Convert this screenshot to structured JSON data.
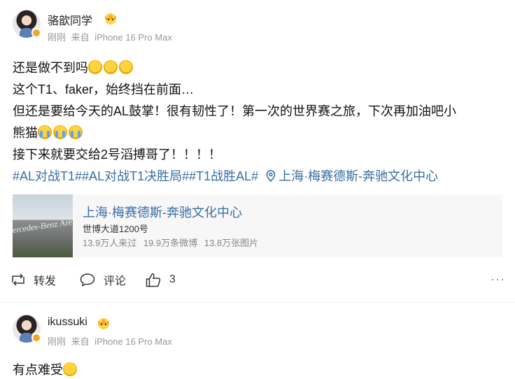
{
  "post1": {
    "author": "骆歆同学",
    "meta_time": "刚刚",
    "meta_from": "来自",
    "meta_device": "iPhone 16 Pro Max",
    "lines": {
      "l1": "还是做不到吗",
      "l2": "这个T1、faker，始终挡在前面…",
      "l3": "但还是要给今天的AL鼓掌！很有韧性了！第一次的世界赛之旅，下次再加油吧小",
      "l4": "熊猫",
      "l5": "接下来就要交给2号滔搏哥了！！！！"
    },
    "hashtags": [
      "#AL对战T1#",
      "#AL对战T1决胜局#",
      "#T1战胜AL#"
    ],
    "location": "上海·梅赛德斯-奔驰文化中心",
    "card": {
      "title": "上海·梅赛德斯-奔驰文化中心",
      "address": "世博大道1200号",
      "stat_visits": "13.9万人来过",
      "stat_posts": "19.9万条微博",
      "stat_photos": "13.8万张图片",
      "image_text": "ercedes-Benz Are"
    },
    "actions": {
      "repost": "转发",
      "comment": "评论",
      "like_count": "3",
      "more": "···"
    }
  },
  "post2": {
    "author": "ikussuki",
    "meta_time": "刚刚",
    "meta_from": "来自",
    "meta_device": "iPhone 16 Pro Max",
    "text": "有点难受"
  },
  "colors": {
    "link": "#3a6ea5",
    "meta": "#999999",
    "badge": "#f5a623"
  },
  "icons": [
    "crown-icon",
    "verified-badge-icon",
    "location-pin-icon",
    "repost-icon",
    "comment-icon",
    "like-icon",
    "more-icon"
  ]
}
